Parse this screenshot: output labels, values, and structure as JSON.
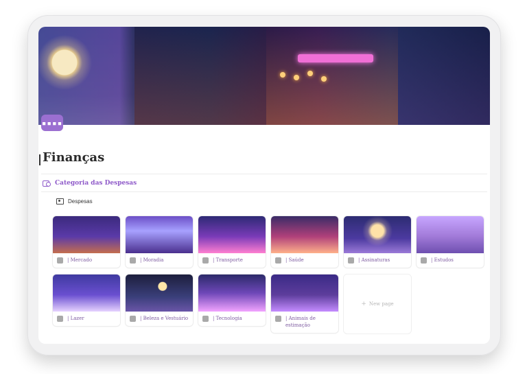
{
  "page": {
    "title": "Finanças",
    "icon": "calendar-icon"
  },
  "section": {
    "title": "Categoria das Despesas",
    "icon": "money-icon"
  },
  "view": {
    "label": "Despesas",
    "icon": "gallery-view-icon"
  },
  "cards": [
    {
      "label": "| Mercado",
      "icon": "basket-icon",
      "accent": "#5a3aa8"
    },
    {
      "label": "| Moradia",
      "icon": "house-icon",
      "accent": "#6c4fc7"
    },
    {
      "label": "| Transporte",
      "icon": "car-icon",
      "accent": "#7a3bb8"
    },
    {
      "label": "| Saúde",
      "icon": "heart-icon",
      "accent": "#b0407a"
    },
    {
      "label": "| Assinaturas",
      "icon": "people-icon",
      "accent": "#4c3aa0"
    },
    {
      "label": "| Estudos",
      "icon": "book-icon",
      "accent": "#a17ad8"
    },
    {
      "label": "| Lazer",
      "icon": "party-icon",
      "accent": "#6a4fd0"
    },
    {
      "label": "| Beleza e Vestuário",
      "icon": "shirt-icon",
      "accent": "#3a3f7a"
    },
    {
      "label": "| Tecnologia",
      "icon": "laptop-icon",
      "accent": "#6e47b8"
    },
    {
      "label": "| Animais de estimação",
      "icon": "cat-icon",
      "accent": "#5d3d9c"
    }
  ],
  "new_page": {
    "label": "New page"
  },
  "colors": {
    "accent": "#8e59c9",
    "card_text": "#7d5aa0"
  }
}
